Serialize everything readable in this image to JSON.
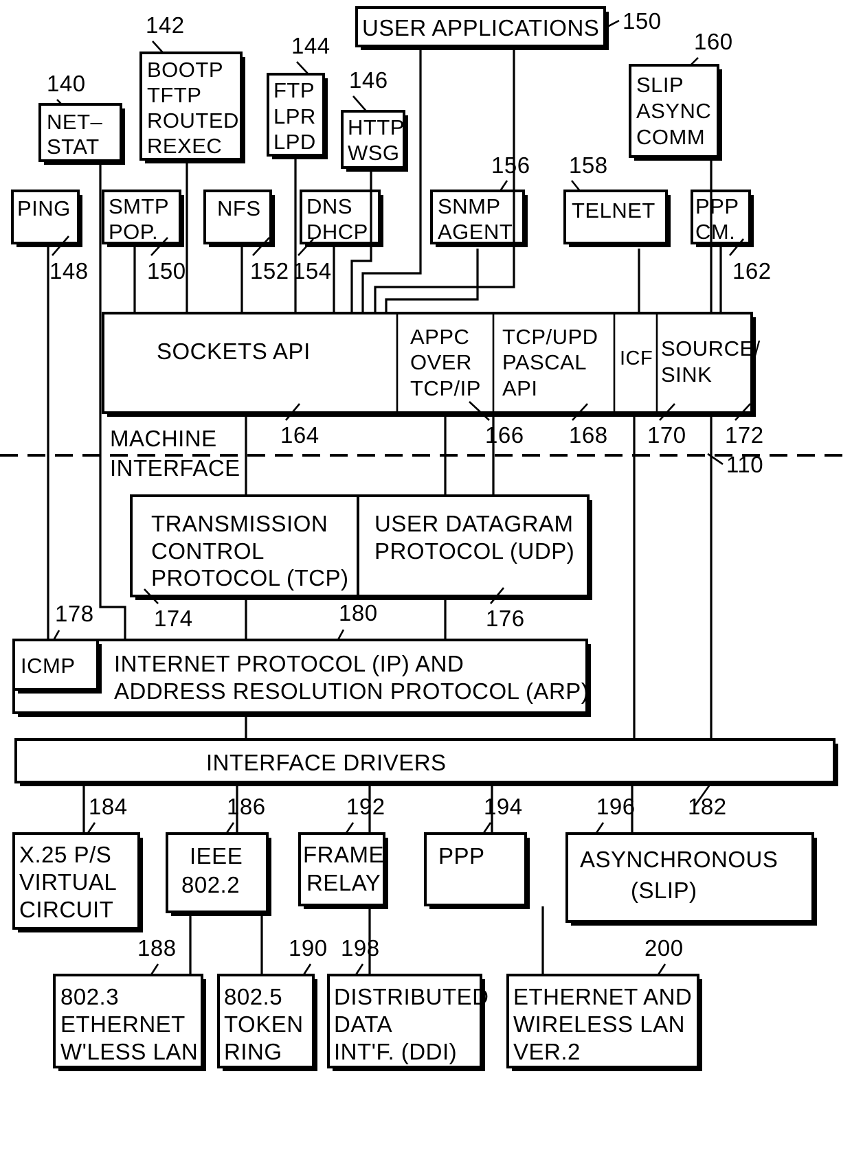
{
  "figure": {
    "type": "patent-block-diagram",
    "title": "TCP/IP protocol stack architecture block diagram",
    "machine_interface_label_line1": "MACHINE",
    "machine_interface_label_line2": "INTERFACE",
    "reference_numerals": {
      "netstat": "140",
      "bootp_group": "142",
      "ftp_group": "144",
      "http_group": "146",
      "user_applications": "150",
      "slip_async": "160",
      "snmp_agent": "156",
      "telnet": "158",
      "ping": "148",
      "smtp_pop": "150",
      "nfs": "152",
      "dns_dhcp": "154",
      "ppp_cm": "162",
      "sockets_api": "164",
      "appc_over_tcpip": "166",
      "tcp_udp_pascal_api": "168",
      "icf": "170",
      "source_sink": "172",
      "machine_interface": "110",
      "tcp": "174",
      "udp": "176",
      "icmp": "178",
      "ip_arp": "180",
      "interface_drivers": "182",
      "x25": "184",
      "ieee8022": "186",
      "ethernet8023": "188",
      "tokenring8025": "190",
      "frame_relay": "192",
      "ppp": "194",
      "asynchronous_slip": "196",
      "ddi": "198",
      "ethernet_wireless_v2": "200"
    },
    "boxes": {
      "netstat": [
        "NET–",
        "STAT"
      ],
      "bootp_group": [
        "BOOTP",
        "TFTP",
        "ROUTED",
        "REXEC"
      ],
      "ftp_group": [
        "FTP",
        "LPR",
        "LPD"
      ],
      "http_group": [
        "HTTP",
        "WSG"
      ],
      "user_applications": [
        "USER APPLICATIONS"
      ],
      "slip_async": [
        "SLIP",
        "ASYNC",
        "COMM"
      ],
      "ping": [
        "PING"
      ],
      "smtp_pop": [
        "SMTP",
        "POP."
      ],
      "nfs": [
        "NFS"
      ],
      "dns_dhcp": [
        "DNS",
        "DHCP"
      ],
      "snmp_agent": [
        "SNMP",
        "AGENT"
      ],
      "telnet": [
        "TELNET"
      ],
      "ppp_cm": [
        "PPP",
        "CM."
      ],
      "sockets_api": [
        "SOCKETS API"
      ],
      "appc": [
        "APPC",
        "OVER",
        "TCP/IP"
      ],
      "pascal_api": [
        "TCP/UPD",
        "PASCAL",
        "API"
      ],
      "icf": [
        "ICF"
      ],
      "source_sink": [
        "SOURCE/",
        "SINK"
      ],
      "tcp": [
        "TRANSMISSION",
        "CONTROL",
        "PROTOCOL (TCP)"
      ],
      "udp": [
        "USER DATAGRAM",
        "PROTOCOL (UDP)"
      ],
      "icmp": [
        "ICMP"
      ],
      "ip_arp": [
        "INTERNET PROTOCOL (IP) AND",
        "ADDRESS RESOLUTION PROTOCOL (ARP)"
      ],
      "interface_drivers": [
        "INTERFACE DRIVERS"
      ],
      "x25": [
        "X.25 P/S",
        "VIRTUAL",
        "CIRCUIT"
      ],
      "ieee8022": [
        "IEEE",
        "802.2"
      ],
      "frame_relay": [
        "FRAME",
        "RELAY"
      ],
      "ppp": [
        "PPP"
      ],
      "asynchronous_slip": [
        "ASYNCHRONOUS",
        "(SLIP)"
      ],
      "ethernet8023": [
        "802.3",
        "ETHERNET",
        "W'LESS LAN"
      ],
      "tokenring8025": [
        "802.5",
        "TOKEN",
        "RING"
      ],
      "ddi": [
        "DISTRIBUTED",
        "DATA",
        "INT'F. (DDI)"
      ],
      "ethernet_wireless_v2": [
        "ETHERNET AND",
        "WIRELESS LAN",
        "VER.2"
      ]
    },
    "colors": {
      "stroke": "#000000",
      "background": "#ffffff"
    }
  }
}
